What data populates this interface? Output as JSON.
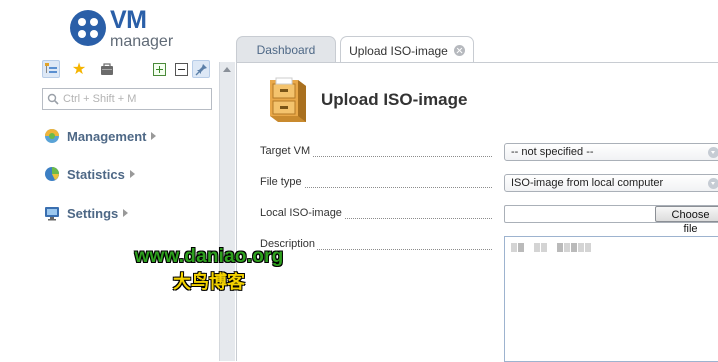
{
  "app": {
    "logo_vm": "VM",
    "logo_manager": "manager"
  },
  "sidebar": {
    "toolbar": {
      "icons": [
        "tree-view-icon",
        "star-icon",
        "briefcase-icon",
        "expand-plus-icon",
        "collapse-minus-icon",
        "pin-icon"
      ]
    },
    "search": {
      "placeholder": "Ctrl + Shift + M",
      "value": ""
    },
    "items": [
      {
        "label": "Management",
        "icon": "management-icon"
      },
      {
        "label": "Statistics",
        "icon": "pie-chart-icon"
      },
      {
        "label": "Settings",
        "icon": "monitor-settings-icon"
      }
    ]
  },
  "tabs": [
    {
      "label": "Dashboard",
      "active": false
    },
    {
      "label": "Upload ISO-image",
      "active": true,
      "closable": true
    }
  ],
  "main": {
    "title": "Upload ISO-image",
    "form": {
      "target_vm": {
        "label": "Target VM",
        "value": "-- not specified --"
      },
      "file_type": {
        "label": "File type",
        "value": "ISO-image from local computer"
      },
      "local_iso": {
        "label": "Local ISO-image",
        "button": "Choose file"
      },
      "description": {
        "label": "Description",
        "value": ""
      }
    }
  },
  "watermark": {
    "url": "www.daniao.org",
    "text": "大鸟博客"
  },
  "colors": {
    "brand": "#2a5fa8",
    "nav_text": "#4e6886",
    "watermark_green": "#2ea01e",
    "watermark_yellow": "#f3d200"
  }
}
